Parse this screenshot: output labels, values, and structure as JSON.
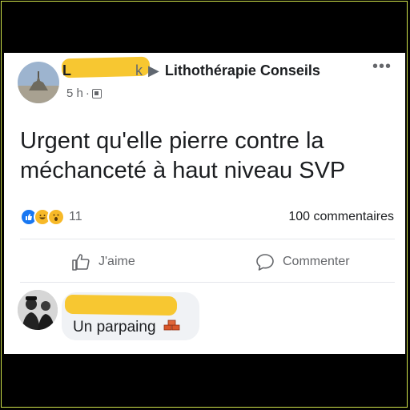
{
  "post": {
    "author_initial": "L",
    "author_fragment": "k",
    "group_name": "Lithothérapie Conseils",
    "time": "5 h",
    "separator": "·",
    "text": "Urgent qu'elle pierre contre la méchanceté à haut niveau SVP",
    "reaction_count": "11",
    "comments_count": "100 commentaires",
    "more_glyph": "•••"
  },
  "actions": {
    "like_label": "J'aime",
    "comment_label": "Commenter"
  },
  "comment": {
    "text": "Un parpaing"
  },
  "colors": {
    "redaction": "#f7c731",
    "accent": "#1877f2",
    "brick": "#d9572b"
  },
  "icons": [
    "more-options-icon",
    "friends-icon",
    "like-reaction-icon",
    "haha-reaction-icon",
    "wow-reaction-icon",
    "thumbs-up-icon",
    "speech-bubble-icon",
    "brick-emoji-icon"
  ]
}
